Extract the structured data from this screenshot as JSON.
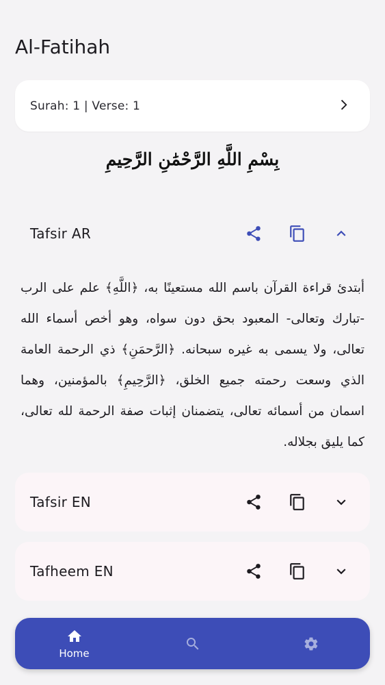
{
  "app": {
    "title": "Al-Fatihah"
  },
  "selector": {
    "label": "Surah: 1 | Verse: 1"
  },
  "verse": {
    "arabic": "بِسْمِ اللَّهِ الرَّحْمَٰنِ الرَّحِيمِ"
  },
  "sections": [
    {
      "title": "Tafsir AR",
      "expanded": true,
      "text": "أبتدئ قراءة القرآن باسم الله مستعينًا به، ﴿اللَّهِ﴾ علم على الرب -تبارك وتعالى- المعبود بحق دون سواه، وهو أخص أسماء الله تعالى، ولا يسمى به غيره سبحانه. ﴿الرَّحمَنِ﴾ ذي الرحمة العامة الذي وسعت رحمته جميع الخلق، ﴿الرَّحِيمِ﴾ بالمؤمنين، وهما اسمان من أسمائه تعالى، يتضمنان إثبات صفة الرحمة لله تعالى، كما يليق بجلاله."
    },
    {
      "title": "Tafsir EN",
      "expanded": false
    },
    {
      "title": "Tafheem EN",
      "expanded": false
    }
  ],
  "icons": {
    "share": "share-icon",
    "copy": "copy-icon",
    "expand": "chevron-down-icon",
    "collapse": "chevron-up-icon",
    "next": "chevron-right-icon"
  },
  "colors": {
    "accent": "#3d4db7",
    "card": "#ffffff",
    "collapsed_card": "#fcf5f8",
    "background": "#f4f3f5"
  },
  "nav": {
    "items": [
      {
        "label": "Home",
        "icon": "home-icon",
        "active": true
      },
      {
        "label": "",
        "icon": "search-icon",
        "active": false
      },
      {
        "label": "",
        "icon": "settings-icon",
        "active": false
      }
    ]
  }
}
